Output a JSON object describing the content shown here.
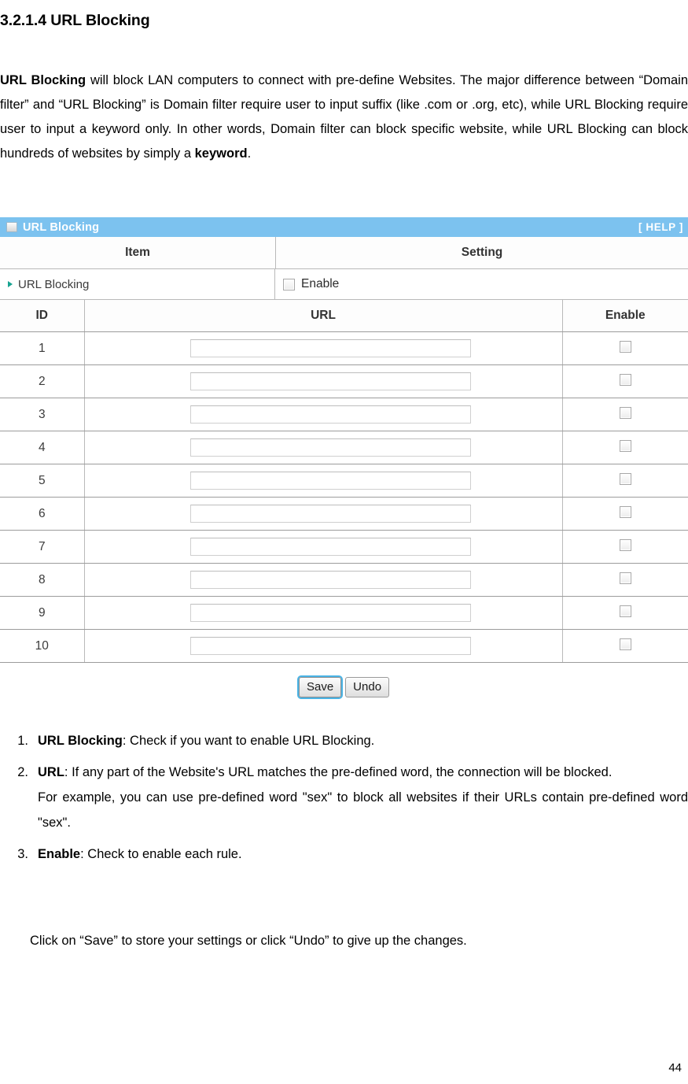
{
  "document": {
    "heading": "3.2.1.4 URL Blocking",
    "intro_parts": {
      "bold_lead": "URL Blocking",
      "rest": " will block LAN computers to connect with pre-define Websites. The major difference between “Domain filter” and “URL Blocking” is Domain filter require user to input suffix (like .com or .org, etc), while URL Blocking require user to input a keyword only. In other words, Domain filter can block specific website, while URL Blocking can block hundreds of websites by simply a ",
      "bold_tail": "keyword",
      "period": "."
    },
    "closing_text": "Click on “Save” to store your settings or click “Undo” to give up the changes.",
    "page_number": "44"
  },
  "panel": {
    "icon": "window-icon",
    "title": "URL Blocking",
    "help_label": "[ HELP ]",
    "title_bar_color": "#7cc2ef",
    "header_row": {
      "item_label": "Item",
      "setting_label": "Setting"
    },
    "enable_row": {
      "marker": "triangle-right-icon",
      "marker_color": "#18a391",
      "label": "URL Blocking",
      "checkbox_label": "Enable",
      "checked": false
    },
    "table": {
      "columns": [
        "ID",
        "URL",
        "Enable"
      ],
      "rows": [
        {
          "id": "1",
          "url": "",
          "enabled": false
        },
        {
          "id": "2",
          "url": "",
          "enabled": false
        },
        {
          "id": "3",
          "url": "",
          "enabled": false
        },
        {
          "id": "4",
          "url": "",
          "enabled": false
        },
        {
          "id": "5",
          "url": "",
          "enabled": false
        },
        {
          "id": "6",
          "url": "",
          "enabled": false
        },
        {
          "id": "7",
          "url": "",
          "enabled": false
        },
        {
          "id": "8",
          "url": "",
          "enabled": false
        },
        {
          "id": "9",
          "url": "",
          "enabled": false
        },
        {
          "id": "10",
          "url": "",
          "enabled": false
        }
      ]
    },
    "buttons": {
      "save_label": "Save",
      "undo_label": "Undo",
      "save_focus_color": "#4ab4e6"
    }
  },
  "notes": [
    {
      "number": "1.",
      "term": "URL Blocking",
      "text": ": Check if you want to enable URL Blocking.",
      "extra": ""
    },
    {
      "number": "2.",
      "term": "URL",
      "text": ": If any part of the Website's URL matches the pre-defined word, the connection will be blocked.",
      "extra": "For example, you can use pre-defined word \"sex\" to block all websites if their URLs contain pre-defined word \"sex\"."
    },
    {
      "number": "3.",
      "term": "Enable",
      "text": ": Check to enable each rule.",
      "extra": ""
    }
  ]
}
